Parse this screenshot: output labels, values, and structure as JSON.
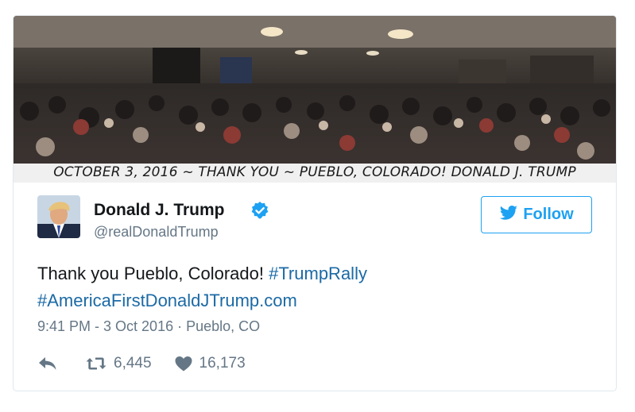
{
  "photo": {
    "caption": "OCTOBER 3, 2016 ~ THANK YOU ~ PUEBLO, COLORADO! DONALD J. TRUMP"
  },
  "author": {
    "name": "Donald J. Trump",
    "handle": "@realDonaldTrump",
    "avatar_icon": "profile-photo",
    "verified_icon": "verified-badge-icon"
  },
  "follow": {
    "icon": "twitter-bird-icon",
    "label": "Follow"
  },
  "tweet": {
    "text": "Thank you Pueblo, Colorado! ",
    "hashtag": "#TrumpRally",
    "link": "#AmericaFirstDonaldJTrump.com"
  },
  "meta": {
    "timestamp": "9:41 PM - 3 Oct 2016",
    "separator": " · ",
    "location": "Pueblo, CO"
  },
  "actions": {
    "reply_icon": "reply-icon",
    "retweet_icon": "retweet-icon",
    "retweet_count": "6,445",
    "like_icon": "heart-icon",
    "like_count": "16,173"
  },
  "colors": {
    "accent": "#1da1f2",
    "link": "#1b6aa5",
    "muted": "#657786",
    "text": "#14171a"
  }
}
